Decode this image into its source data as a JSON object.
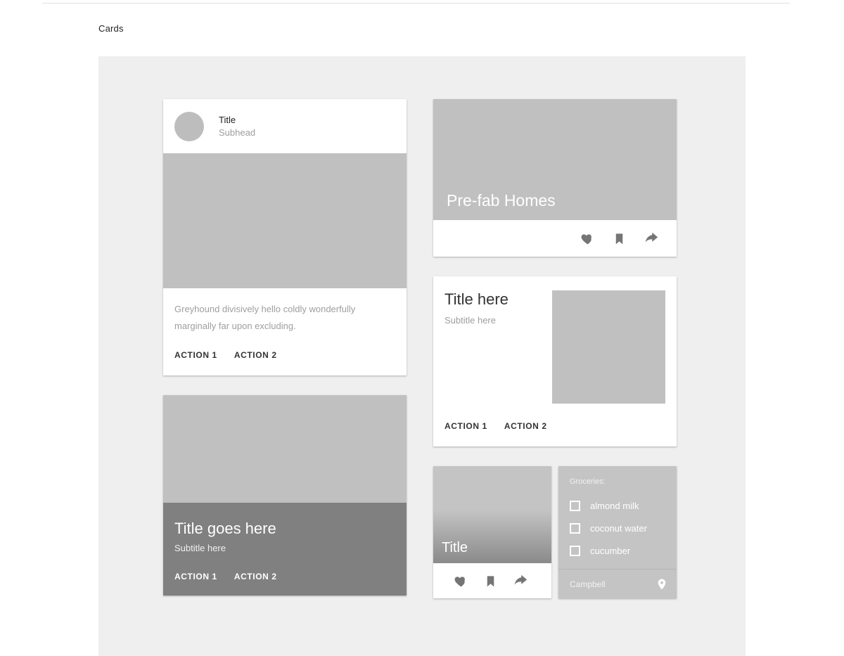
{
  "page": {
    "title": "Cards"
  },
  "cards": {
    "basic": {
      "avatar_icon": "avatar-circle-icon",
      "title": "Title",
      "subhead": "Subhead",
      "body": "Greyhound divisively hello coldly wonderfully marginally far upon excluding.",
      "action1": "ACTION 1",
      "action2": "ACTION 2"
    },
    "overlay": {
      "title": "Title goes here",
      "subtitle": "Subtitle here",
      "action1": "ACTION 1",
      "action2": "ACTION 2"
    },
    "hero": {
      "title": "Pre-fab Homes",
      "icons": [
        {
          "name": "heart-icon",
          "label": "favorite"
        },
        {
          "name": "bookmark-icon",
          "label": "bookmark"
        },
        {
          "name": "share-icon",
          "label": "share"
        }
      ]
    },
    "split": {
      "title": "Title here",
      "subtitle": "Subtitle here",
      "action1": "ACTION 1",
      "action2": "ACTION 2",
      "thumbnail": "image-placeholder"
    },
    "mini": {
      "title": "Title",
      "icons": [
        {
          "name": "heart-icon",
          "label": "favorite"
        },
        {
          "name": "bookmark-icon",
          "label": "bookmark"
        },
        {
          "name": "share-icon",
          "label": "share"
        }
      ]
    },
    "list": {
      "heading": "Groceries:",
      "items": [
        {
          "label": "almond milk",
          "checked": false
        },
        {
          "label": "coconut water",
          "checked": false
        },
        {
          "label": "cucumber",
          "checked": false
        }
      ],
      "footer_label": "Campbell",
      "footer_icon": "map-pin-icon"
    }
  },
  "colors": {
    "canvas_background": "#efefef",
    "card_background": "#ffffff",
    "media_placeholder": "#c0c0c0",
    "overlay_panel": "#808080",
    "list_card": "#c4c4c4",
    "icon_gray": "#757575",
    "text_primary": "#212121",
    "text_secondary": "#9e9e9e"
  }
}
